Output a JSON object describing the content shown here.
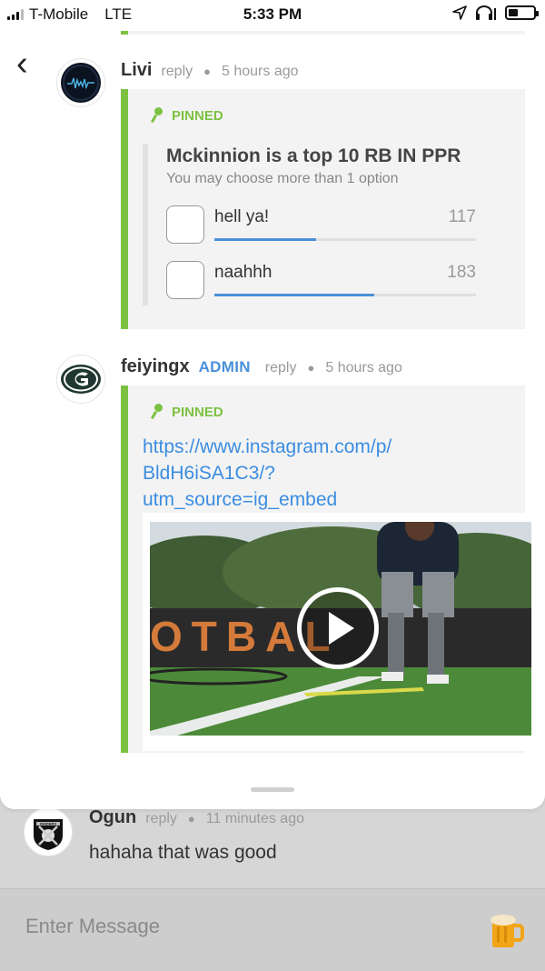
{
  "status_bar": {
    "carrier": "T-Mobile",
    "network": "LTE",
    "time": "5:33 PM",
    "icons": [
      "signal-icon",
      "location-arrow-icon",
      "headphones-icon",
      "battery-icon"
    ]
  },
  "messages": [
    {
      "user": "Livi",
      "reply_label": "reply",
      "time": "5 hours ago",
      "pinned_label": "PINNED",
      "poll": {
        "question": "Mckinnion is a top 10 RB IN PPR",
        "subtitle": "You may choose more than 1 option",
        "options": [
          {
            "label": "hell ya!",
            "count": "117",
            "fraction": 0.39
          },
          {
            "label": "naahhh",
            "count": "183",
            "fraction": 0.61
          }
        ]
      }
    },
    {
      "user": "feiyingx",
      "badge": "ADMIN",
      "reply_label": "reply",
      "time": "5 hours ago",
      "pinned_label": "PINNED",
      "link_lines": [
        "https://www.instagram.com/p/",
        "BldH6iSA1C3/?",
        "utm_source=ig_embed"
      ],
      "embed_banner_text": "OTBAL"
    }
  ],
  "background_message": {
    "user": "Ogun",
    "reply_label": "reply",
    "time": "11 minutes ago",
    "text": "hahaha that was good",
    "avatar_text": "RAIDERS"
  },
  "input": {
    "placeholder": "Enter Message"
  },
  "colors": {
    "accent_green": "#7cc142",
    "link_blue": "#3b8de0",
    "admin_blue": "#4a90d9"
  }
}
